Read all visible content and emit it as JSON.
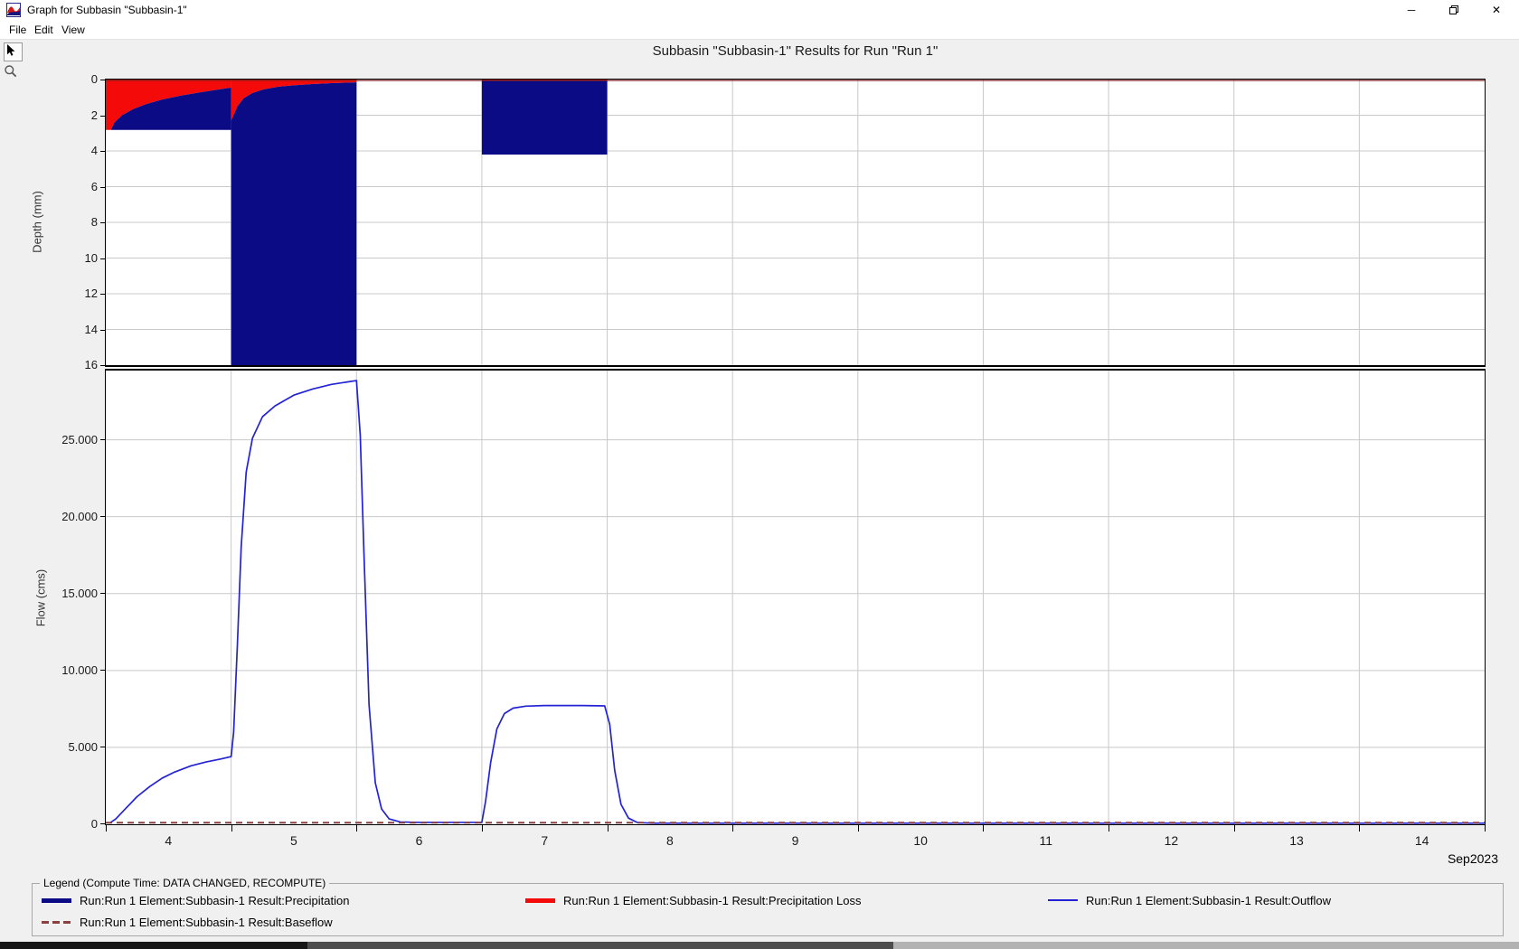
{
  "window": {
    "title": "Graph for Subbasin \"Subbasin-1\"",
    "minimize_glyph": "─",
    "close_glyph": "✕"
  },
  "menu": {
    "items": [
      "File",
      "Edit",
      "View"
    ]
  },
  "toolbar": {
    "buttons": [
      "pointer",
      "zoom"
    ]
  },
  "chart_title": "Subbasin \"Subbasin-1\" Results for Run \"Run 1\"",
  "colors": {
    "precipitation": "#0b0b86",
    "precipitation_loss": "#f50a0a",
    "outflow": "#2323d6",
    "baseflow": "#8b4040",
    "grid": "#c9c9c9",
    "axis": "#000000"
  },
  "chart_data": [
    {
      "type": "area",
      "name": "precipitation-depth-chart",
      "ylabel": "Depth (mm)",
      "xlim": [
        3.5,
        14.5
      ],
      "ylim": [
        0,
        16
      ],
      "y_inverted": true,
      "yticks": [
        [
          0,
          "0"
        ],
        [
          2,
          "2"
        ],
        [
          4,
          "4"
        ],
        [
          6,
          "6"
        ],
        [
          8,
          "8"
        ],
        [
          10,
          "10"
        ],
        [
          12,
          "12"
        ],
        [
          14,
          "14"
        ],
        [
          16,
          "16"
        ]
      ],
      "storms": [
        {
          "start": 3.5,
          "end": 4.5,
          "total_depth": 2.82,
          "loss_boundary": [
            [
              3.5,
              2.82
            ],
            [
              3.54,
              2.82
            ],
            [
              3.57,
              2.4
            ],
            [
              3.63,
              2.0
            ],
            [
              3.72,
              1.65
            ],
            [
              3.82,
              1.38
            ],
            [
              3.95,
              1.12
            ],
            [
              4.1,
              0.9
            ],
            [
              4.25,
              0.72
            ],
            [
              4.4,
              0.56
            ],
            [
              4.5,
              0.45
            ]
          ]
        },
        {
          "start": 4.5,
          "end": 5.5,
          "total_depth": 16,
          "loss_boundary": [
            [
              4.5,
              2.3
            ],
            [
              4.55,
              1.5
            ],
            [
              4.6,
              1.05
            ],
            [
              4.67,
              0.75
            ],
            [
              4.76,
              0.55
            ],
            [
              4.88,
              0.4
            ],
            [
              5.0,
              0.32
            ],
            [
              5.15,
              0.25
            ],
            [
              5.3,
              0.2
            ],
            [
              5.5,
              0.16
            ]
          ]
        },
        {
          "start": 6.5,
          "end": 7.5,
          "total_depth": 4.2,
          "loss_boundary": [
            [
              6.5,
              0.07
            ],
            [
              7.5,
              0.07
            ]
          ]
        }
      ],
      "loss_zero_line": 0.05
    },
    {
      "type": "line",
      "name": "flow-chart",
      "ylabel": "Flow (cms)",
      "xlim": [
        3.5,
        14.5
      ],
      "ylim": [
        0,
        29.5
      ],
      "yticks": [
        [
          0,
          "0"
        ],
        [
          5,
          "5.000"
        ],
        [
          10,
          "10.000"
        ],
        [
          15,
          "15.000"
        ],
        [
          20,
          "20.000"
        ],
        [
          25,
          "25.000"
        ]
      ],
      "series": [
        {
          "name": "Outflow",
          "color_key": "outflow",
          "width": 1.7,
          "dashed": false,
          "points": [
            [
              3.53,
              0
            ],
            [
              3.58,
              0.35
            ],
            [
              3.65,
              0.95
            ],
            [
              3.75,
              1.8
            ],
            [
              3.85,
              2.45
            ],
            [
              3.95,
              3.0
            ],
            [
              4.05,
              3.4
            ],
            [
              4.18,
              3.8
            ],
            [
              4.3,
              4.05
            ],
            [
              4.42,
              4.25
            ],
            [
              4.5,
              4.4
            ],
            [
              4.52,
              6
            ],
            [
              4.55,
              11.7
            ],
            [
              4.58,
              18
            ],
            [
              4.62,
              22.9
            ],
            [
              4.67,
              25.1
            ],
            [
              4.75,
              26.5
            ],
            [
              4.85,
              27.2
            ],
            [
              5.0,
              27.9
            ],
            [
              5.15,
              28.3
            ],
            [
              5.3,
              28.6
            ],
            [
              5.42,
              28.75
            ],
            [
              5.5,
              28.85
            ],
            [
              5.53,
              25.3
            ],
            [
              5.56,
              17.5
            ],
            [
              5.6,
              7.8
            ],
            [
              5.65,
              2.7
            ],
            [
              5.7,
              1.0
            ],
            [
              5.76,
              0.35
            ],
            [
              5.85,
              0.15
            ],
            [
              6.0,
              0.12
            ],
            [
              6.5,
              0.12
            ],
            [
              6.53,
              1.5
            ],
            [
              6.57,
              4.0
            ],
            [
              6.62,
              6.2
            ],
            [
              6.68,
              7.2
            ],
            [
              6.75,
              7.55
            ],
            [
              6.85,
              7.68
            ],
            [
              7.0,
              7.72
            ],
            [
              7.3,
              7.72
            ],
            [
              7.48,
              7.7
            ],
            [
              7.52,
              6.5
            ],
            [
              7.56,
              3.5
            ],
            [
              7.61,
              1.3
            ],
            [
              7.67,
              0.4
            ],
            [
              7.74,
              0.12
            ],
            [
              7.85,
              0.04
            ],
            [
              8.0,
              0.02
            ],
            [
              14.5,
              0.02
            ]
          ]
        },
        {
          "name": "Baseflow",
          "color_key": "baseflow",
          "width": 2,
          "dashed": true,
          "points": [
            [
              3.5,
              0.1
            ],
            [
              14.5,
              0.1
            ]
          ]
        }
      ]
    }
  ],
  "x_axis": {
    "tick_positions": [
      3.5,
      4.5,
      5.5,
      6.5,
      7.5,
      8.5,
      9.5,
      10.5,
      11.5,
      12.5,
      13.5,
      14.5
    ],
    "labels": [
      [
        4,
        "4"
      ],
      [
        5,
        "5"
      ],
      [
        6,
        "6"
      ],
      [
        7,
        "7"
      ],
      [
        8,
        "8"
      ],
      [
        9,
        "9"
      ],
      [
        10,
        "10"
      ],
      [
        11,
        "11"
      ],
      [
        12,
        "12"
      ],
      [
        13,
        "13"
      ],
      [
        14,
        "14"
      ]
    ],
    "month_label": "Sep2023"
  },
  "legend": {
    "title": "Legend (Compute Time: DATA CHANGED, RECOMPUTE)",
    "columns": [
      [
        {
          "swatch": "precipitation",
          "label": "Run:Run 1 Element:Subbasin-1 Result:Precipitation"
        },
        {
          "swatch": "baseflow",
          "label": "Run:Run 1 Element:Subbasin-1 Result:Baseflow"
        }
      ],
      [
        {
          "swatch": "precipitation_loss",
          "label": "Run:Run 1 Element:Subbasin-1 Result:Precipitation Loss"
        }
      ],
      [
        {
          "swatch": "outflow",
          "label": "Run:Run 1 Element:Subbasin-1 Result:Outflow"
        }
      ]
    ]
  }
}
